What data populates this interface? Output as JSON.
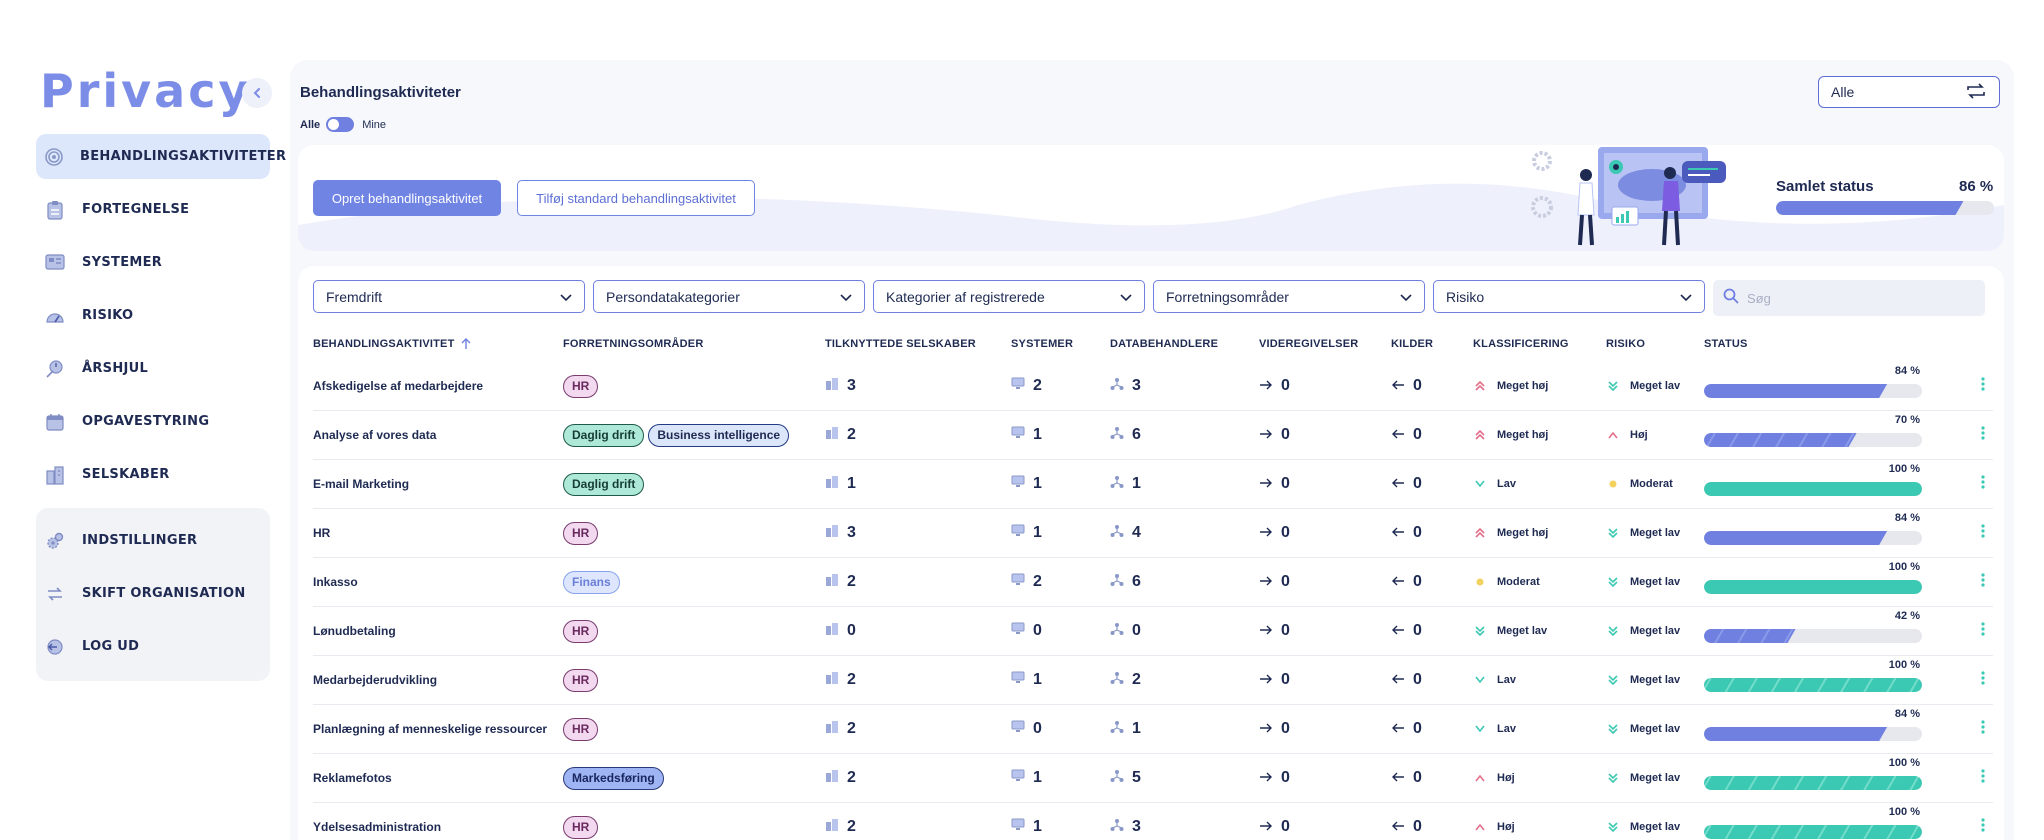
{
  "app": {
    "logo": "Privacy"
  },
  "sidebar": {
    "items": [
      {
        "label": "BEHANDLINGSAKTIVITETER",
        "icon": "fingerprint-icon",
        "active": true
      },
      {
        "label": "FORTEGNELSE",
        "icon": "clipboard-icon"
      },
      {
        "label": "SYSTEMER",
        "icon": "system-icon"
      },
      {
        "label": "RISIKO",
        "icon": "gauge-icon"
      },
      {
        "label": "ÅRSHJUL",
        "icon": "year-wheel-icon"
      },
      {
        "label": "OPGAVESTYRING",
        "icon": "calendar-icon"
      },
      {
        "label": "SELSKABER",
        "icon": "buildings-icon"
      }
    ],
    "secondary": [
      {
        "label": "INDSTILLINGER",
        "icon": "gears-icon"
      },
      {
        "label": "SKIFT ORGANISATION",
        "icon": "switch-icon"
      },
      {
        "label": "LOG UD",
        "icon": "logout-icon"
      }
    ]
  },
  "header": {
    "title": "Behandlingsaktiviteter",
    "toggle_all": "Alle",
    "toggle_mine": "Mine",
    "org_select": "Alle"
  },
  "banner": {
    "create_button": "Opret behandlingsaktivitet",
    "add_standard_button": "Tilføj standard behandlingsaktivitet",
    "status_title": "Samlet status",
    "status_pct": "86 %",
    "status_value": 86
  },
  "filters": {
    "items": [
      "Fremdrift",
      "Persondatakategorier",
      "Kategorier af registrerede",
      "Forretningsområder",
      "Risiko"
    ],
    "search_placeholder": "Søg"
  },
  "table": {
    "columns": {
      "name": "BEHANDLINGSAKTIVITET",
      "areas": "FORRETNINGSOMRÅDER",
      "companies": "TILKNYTTEDE SELSKABER",
      "systems": "SYSTEMER",
      "processors": "DATABEHANDLERE",
      "disclosures": "VIDEREGIVELSER",
      "sources": "KILDER",
      "classification": "KLASSIFICERING",
      "risk": "RISIKO",
      "status": "STATUS"
    },
    "rows": [
      {
        "name": "Afskedigelse af medarbejdere",
        "tags": [
          "HR"
        ],
        "companies": "3",
        "systems": "2",
        "processors": "3",
        "disclosures": "0",
        "sources": "0",
        "classification": "Meget høj",
        "risk": "Meget lav",
        "status": 84,
        "status_label": "84 %"
      },
      {
        "name": "Analyse af vores data",
        "tags": [
          "Daglig drift",
          "Business intelligence"
        ],
        "companies": "2",
        "systems": "1",
        "processors": "6",
        "disclosures": "0",
        "sources": "0",
        "classification": "Meget høj",
        "risk": "Høj",
        "status": 70,
        "status_label": "70 %"
      },
      {
        "name": "E-mail Marketing",
        "tags": [
          "Daglig drift"
        ],
        "companies": "1",
        "systems": "1",
        "processors": "1",
        "disclosures": "0",
        "sources": "0",
        "classification": "Lav",
        "risk": "Moderat",
        "status": 100,
        "status_label": "100 %"
      },
      {
        "name": "HR",
        "tags": [
          "HR"
        ],
        "companies": "3",
        "systems": "1",
        "processors": "4",
        "disclosures": "0",
        "sources": "0",
        "classification": "Meget høj",
        "risk": "Meget lav",
        "status": 84,
        "status_label": "84 %"
      },
      {
        "name": "Inkasso",
        "tags": [
          "Finans"
        ],
        "companies": "2",
        "systems": "2",
        "processors": "6",
        "disclosures": "0",
        "sources": "0",
        "classification": "Moderat",
        "risk": "Meget lav",
        "status": 100,
        "status_label": "100 %"
      },
      {
        "name": "Lønudbetaling",
        "tags": [
          "HR"
        ],
        "companies": "0",
        "systems": "0",
        "processors": "0",
        "disclosures": "0",
        "sources": "0",
        "classification": "Meget lav",
        "risk": "Meget lav",
        "status": 42,
        "status_label": "42 %"
      },
      {
        "name": "Medarbejderudvikling",
        "tags": [
          "HR"
        ],
        "companies": "2",
        "systems": "1",
        "processors": "2",
        "disclosures": "0",
        "sources": "0",
        "classification": "Lav",
        "risk": "Meget lav",
        "status": 100,
        "status_label": "100 %"
      },
      {
        "name": "Planlægning af menneskelige ressourcer",
        "tags": [
          "HR"
        ],
        "companies": "2",
        "systems": "0",
        "processors": "1",
        "disclosures": "0",
        "sources": "0",
        "classification": "Lav",
        "risk": "Meget lav",
        "status": 84,
        "status_label": "84 %"
      },
      {
        "name": "Reklamefotos",
        "tags": [
          "Markedsføring"
        ],
        "companies": "2",
        "systems": "1",
        "processors": "5",
        "disclosures": "0",
        "sources": "0",
        "classification": "Høj",
        "risk": "Meget lav",
        "status": 100,
        "status_label": "100 %"
      },
      {
        "name": "Ydelsesadministration",
        "tags": [
          "HR"
        ],
        "companies": "2",
        "systems": "1",
        "processors": "3",
        "disclosures": "0",
        "sources": "0",
        "classification": "Høj",
        "risk": "Meget lav",
        "status": 100,
        "status_label": "100 %"
      }
    ]
  },
  "colors": {
    "accent": "#7084e4",
    "progress_blue": "#6f80e0",
    "progress_teal": "#3cc9b4",
    "level_high": "#e46f8a",
    "level_low": "#3cc9b4",
    "level_moderate": "#f2d15c"
  }
}
